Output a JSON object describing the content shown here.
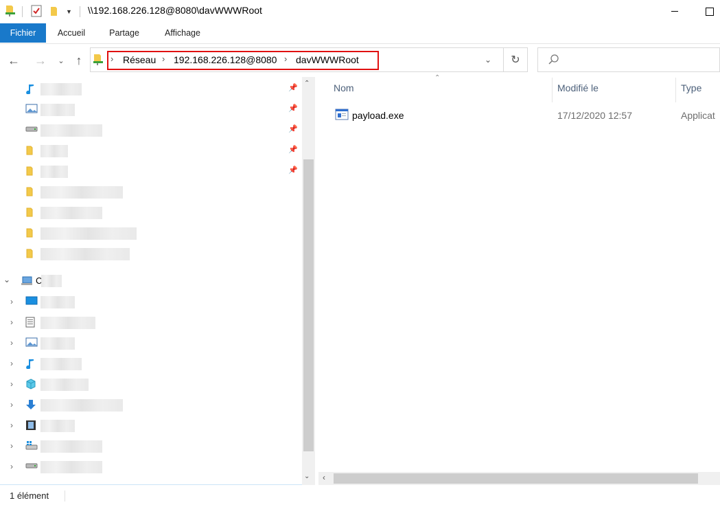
{
  "window": {
    "title": "\\\\192.168.226.128@8080\\davWWWRoot"
  },
  "ribbon": {
    "tabs": [
      {
        "label": "Fichier"
      },
      {
        "label": "Accueil"
      },
      {
        "label": "Partage"
      },
      {
        "label": "Affichage"
      }
    ]
  },
  "address_bar": {
    "crumbs": [
      "Réseau",
      "192.168.226.128@8080",
      "davWWWRoot"
    ]
  },
  "search": {
    "placeholder": ""
  },
  "nav_pane": {
    "quick_access_icons": [
      "music-icon",
      "pictures-icon",
      "drive-icon",
      "folder-icon",
      "folder-icon",
      "folder-icon",
      "folder-icon",
      "folder-icon",
      "folder-icon"
    ],
    "this_pc_label_initial": "C",
    "this_pc_children_icons": [
      "desktop-icon",
      "documents-icon",
      "pictures-icon",
      "music-icon",
      "3d-objects-icon",
      "downloads-icon",
      "videos-icon",
      "windows-drive-icon",
      "drive-icon"
    ]
  },
  "columns": [
    {
      "label": "Nom"
    },
    {
      "label": "Modifié le"
    },
    {
      "label": "Type"
    }
  ],
  "files": [
    {
      "name": "payload.exe",
      "modified": "17/12/2020 12:57",
      "type": "Applicat"
    }
  ],
  "status_bar": {
    "text": "1 élément"
  },
  "colors": {
    "file_tab": "#1979ca",
    "highlight": "#e01010",
    "column_header": "#4c607a"
  }
}
